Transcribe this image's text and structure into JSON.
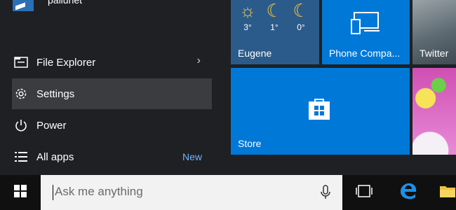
{
  "user": {
    "name": "pallunet"
  },
  "menu": {
    "file_explorer": "File Explorer",
    "settings": "Settings",
    "power": "Power",
    "all_apps": "All apps",
    "new_badge": "New"
  },
  "tiles": {
    "weather": {
      "label": "Eugene",
      "forecast": [
        {
          "icon": "sun-icon",
          "temp": "3°"
        },
        {
          "icon": "moon-icon",
          "temp": "1°"
        },
        {
          "icon": "moon-icon",
          "temp": "0°"
        }
      ]
    },
    "phone": {
      "label": "Phone Compa..."
    },
    "twitter": {
      "label": "Twitter"
    },
    "store": {
      "label": "Store"
    }
  },
  "taskbar": {
    "search_placeholder": "Ask me anything"
  },
  "colors": {
    "accent": "#0078d7",
    "menu_bg": "#1e2023",
    "selected_bg": "#3a3c40",
    "taskbar_bg": "#101010",
    "new_badge": "#6fb3ff"
  }
}
